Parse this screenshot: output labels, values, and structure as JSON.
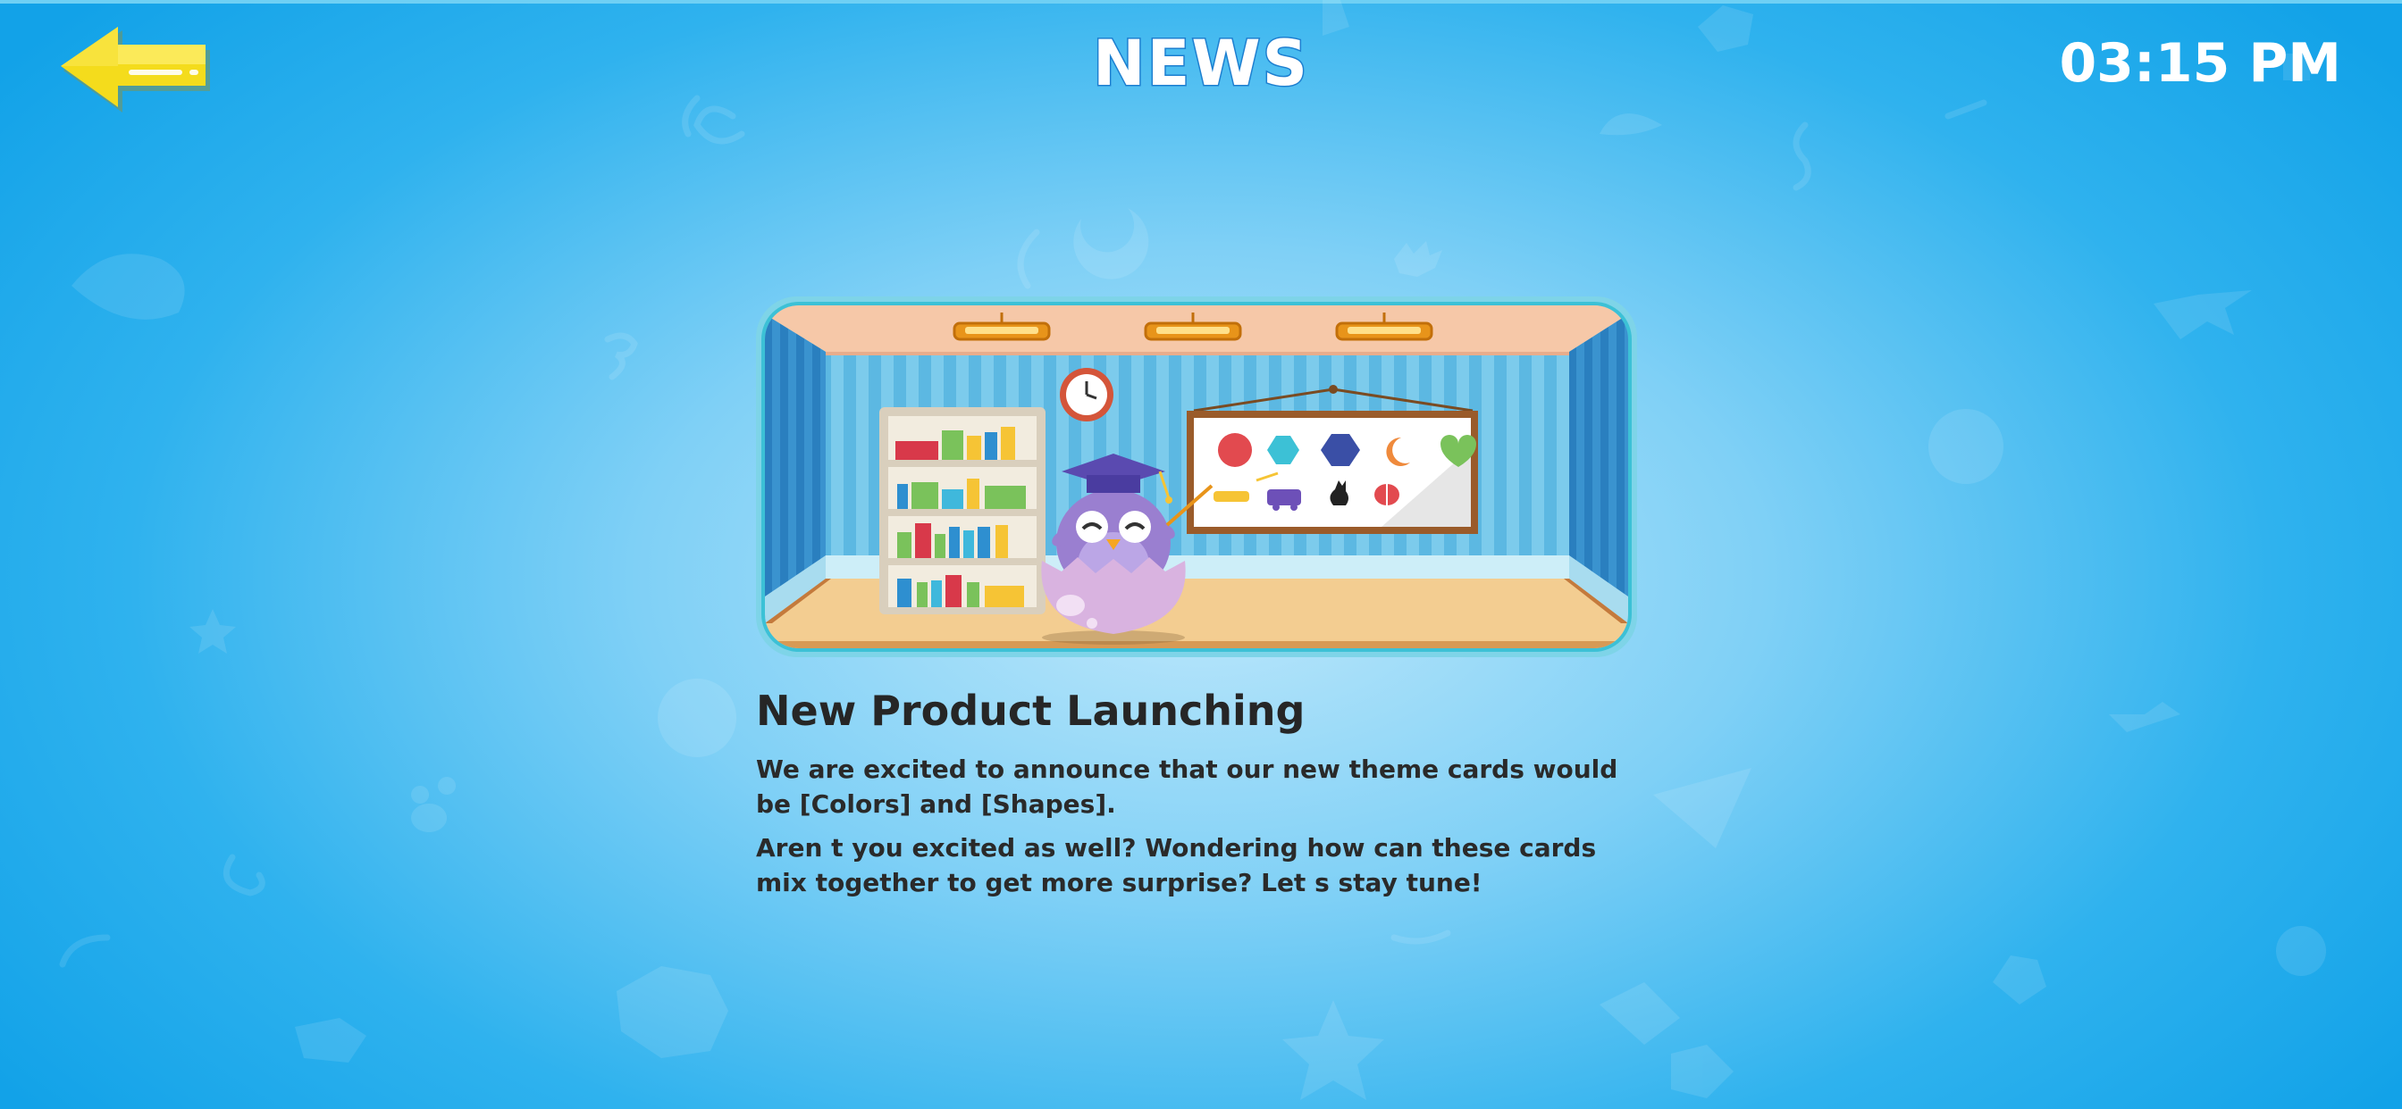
{
  "header": {
    "title": "NEWS",
    "time": "03:15 PM",
    "back_icon": "arrow-left-icon"
  },
  "news": {
    "headline": "New Product Launching",
    "paragraphs": [
      "We are excited to announce that our new theme cards would be [Colors] and [Shapes].",
      "Aren t you excited as well? Wondering how can these cards mix together to get more surprise? Let s stay tune!"
    ],
    "illustration": "owl-teacher-classroom-illustration"
  },
  "colors": {
    "background": "#2fb2ee",
    "title_outline": "#1d7fd0",
    "back_arrow": "#f4dc1c",
    "text": "#262626"
  }
}
